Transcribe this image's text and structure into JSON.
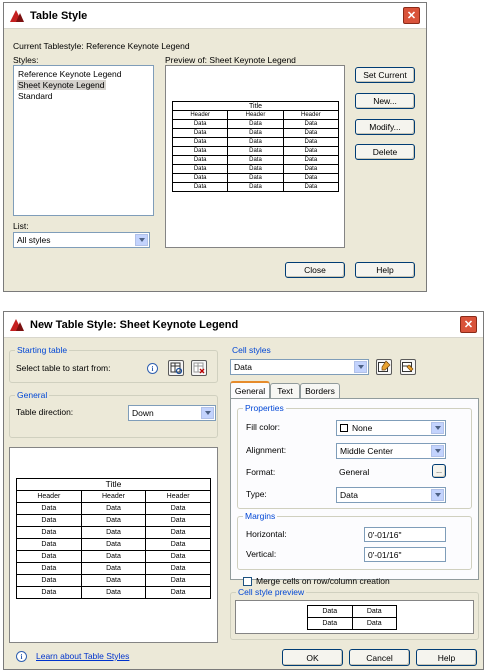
{
  "d1": {
    "title": "Table Style",
    "current_label": "Current Tablestyle: Reference Keynote Legend",
    "styles_label": "Styles:",
    "styles": [
      "Reference Keynote Legend",
      "Sheet Keynote Legend",
      "Standard"
    ],
    "preview_label": "Preview of: Sheet Keynote Legend",
    "list_label": "List:",
    "list_value": "All styles",
    "buttons": {
      "set_current": "Set Current",
      "new": "New...",
      "modify": "Modify...",
      "delete": "Delete",
      "close": "Close",
      "help": "Help"
    }
  },
  "d2": {
    "title": "New Table Style: Sheet Keynote Legend",
    "starting_table_label": "Starting table",
    "select_table_label": "Select table to start from:",
    "general_label": "General",
    "table_direction_label": "Table direction:",
    "table_direction_value": "Down",
    "cell_styles_label": "Cell styles",
    "cell_style_value": "Data",
    "tabs": [
      "General",
      "Text",
      "Borders"
    ],
    "properties_label": "Properties",
    "fill_color_label": "Fill color:",
    "fill_color_value": "None",
    "alignment_label": "Alignment:",
    "alignment_value": "Middle Center",
    "format_label": "Format:",
    "format_value": "General",
    "format_btn": "...",
    "type_label": "Type:",
    "type_value": "Data",
    "margins_label": "Margins",
    "horizontal_label": "Horizontal:",
    "horizontal_value": "0'-01/16\"",
    "vertical_label": "Vertical:",
    "vertical_value": "0'-01/16\"",
    "merge_label": "Merge cells on row/column creation",
    "cell_preview_label": "Cell style preview",
    "cell_preview": [
      [
        "Data",
        "Data"
      ],
      [
        "Data",
        "Data"
      ]
    ],
    "learn_link": "Learn about Table Styles",
    "buttons": {
      "ok": "OK",
      "cancel": "Cancel",
      "help": "Help"
    }
  },
  "preview_table": {
    "title": "Title",
    "headers": [
      "Header",
      "Header",
      "Header"
    ],
    "rows": [
      [
        "Data",
        "Data",
        "Data"
      ],
      [
        "Data",
        "Data",
        "Data"
      ],
      [
        "Data",
        "Data",
        "Data"
      ],
      [
        "Data",
        "Data",
        "Data"
      ],
      [
        "Data",
        "Data",
        "Data"
      ],
      [
        "Data",
        "Data",
        "Data"
      ],
      [
        "Data",
        "Data",
        "Data"
      ],
      [
        "Data",
        "Data",
        "Data"
      ]
    ]
  }
}
